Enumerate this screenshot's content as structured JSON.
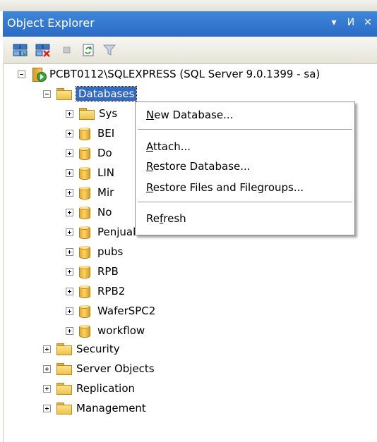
{
  "panel": {
    "title": "Object Explorer",
    "pin_glyph": "▾",
    "autohide_glyph": "И",
    "close_glyph": "✕"
  },
  "toolbar": {
    "icons": [
      "connect-icon",
      "disconnect-icon",
      "stop-icon",
      "refresh-icon",
      "filter-icon"
    ]
  },
  "tree": {
    "server": "PCBT0112\\SQLEXPRESS (SQL Server 9.0.1399 - sa)",
    "databases_folder": "Databases",
    "databases": [
      {
        "label": "Sys",
        "icon": "folder"
      },
      {
        "label": "BEI",
        "icon": "database"
      },
      {
        "label": "Do",
        "icon": "database"
      },
      {
        "label": "LIN",
        "icon": "database"
      },
      {
        "label": "Mir",
        "icon": "database"
      },
      {
        "label": "No",
        "icon": "database"
      },
      {
        "label": "PenjualanHP",
        "icon": "database"
      },
      {
        "label": "pubs",
        "icon": "database"
      },
      {
        "label": "RPB",
        "icon": "database"
      },
      {
        "label": "RPB2",
        "icon": "database"
      },
      {
        "label": "WaferSPC2",
        "icon": "database"
      },
      {
        "label": "workflow",
        "icon": "database"
      }
    ],
    "folders": [
      "Security",
      "Server Objects",
      "Replication",
      "Management"
    ]
  },
  "context_menu": {
    "new_database": {
      "pre": "",
      "key": "N",
      "post": "ew Database..."
    },
    "attach": {
      "pre": "",
      "key": "A",
      "post": "ttach..."
    },
    "restore_database": {
      "pre": "",
      "key": "R",
      "post": "estore Database..."
    },
    "restore_files": {
      "pre": "",
      "key": "R",
      "post": "estore Files and Filegroups..."
    },
    "refresh": {
      "pre": "Re",
      "key": "f",
      "post": "resh"
    }
  }
}
